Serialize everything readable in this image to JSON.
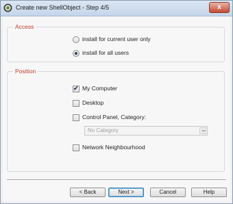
{
  "window": {
    "title": "Create new ShellObject - Step 4/5",
    "close_label": "x"
  },
  "access": {
    "group_label": "Access",
    "options": [
      {
        "label": "install for current user only",
        "selected": false
      },
      {
        "label": "install for all users",
        "selected": true
      }
    ]
  },
  "position": {
    "group_label": "Position",
    "my_computer": {
      "label": "My Computer",
      "checked": true
    },
    "desktop": {
      "label": "Desktop",
      "checked": false
    },
    "control_panel": {
      "label": "Control Panel, Category:",
      "checked": false
    },
    "category_select": {
      "value": "No Category",
      "enabled": false
    },
    "network": {
      "label": "Network Neighbourhood",
      "checked": false
    }
  },
  "buttons": {
    "back": "< Back",
    "next": "Next >",
    "cancel": "Cancel",
    "help": "Help"
  },
  "icons": {
    "app": "shellobject-app-icon",
    "check": "✔"
  }
}
